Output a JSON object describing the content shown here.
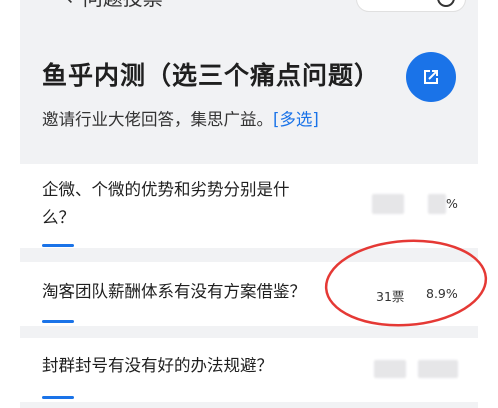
{
  "topbar": {
    "back_icon": "arrow-left-icon",
    "title": "←问题投票"
  },
  "header": {
    "title": "鱼乎内测（选三个痛点问题）",
    "subtitle": "邀请行业大佬回答，集思广益。",
    "multi_tag": "[多选]",
    "share_icon": "open-external-icon",
    "accent_color": "#1a73e8"
  },
  "questions": [
    {
      "text": "企微、个微的优势和劣势分别是什么？",
      "votes": "",
      "percent": "%"
    },
    {
      "text": "淘客团队薪酬体系有没有方案借鉴？",
      "votes": "31票",
      "percent": "8.9%"
    },
    {
      "text": "封群封号有没有好的办法规避？",
      "votes": "",
      "percent": ""
    }
  ],
  "annotation": {
    "color": "#e53935"
  }
}
